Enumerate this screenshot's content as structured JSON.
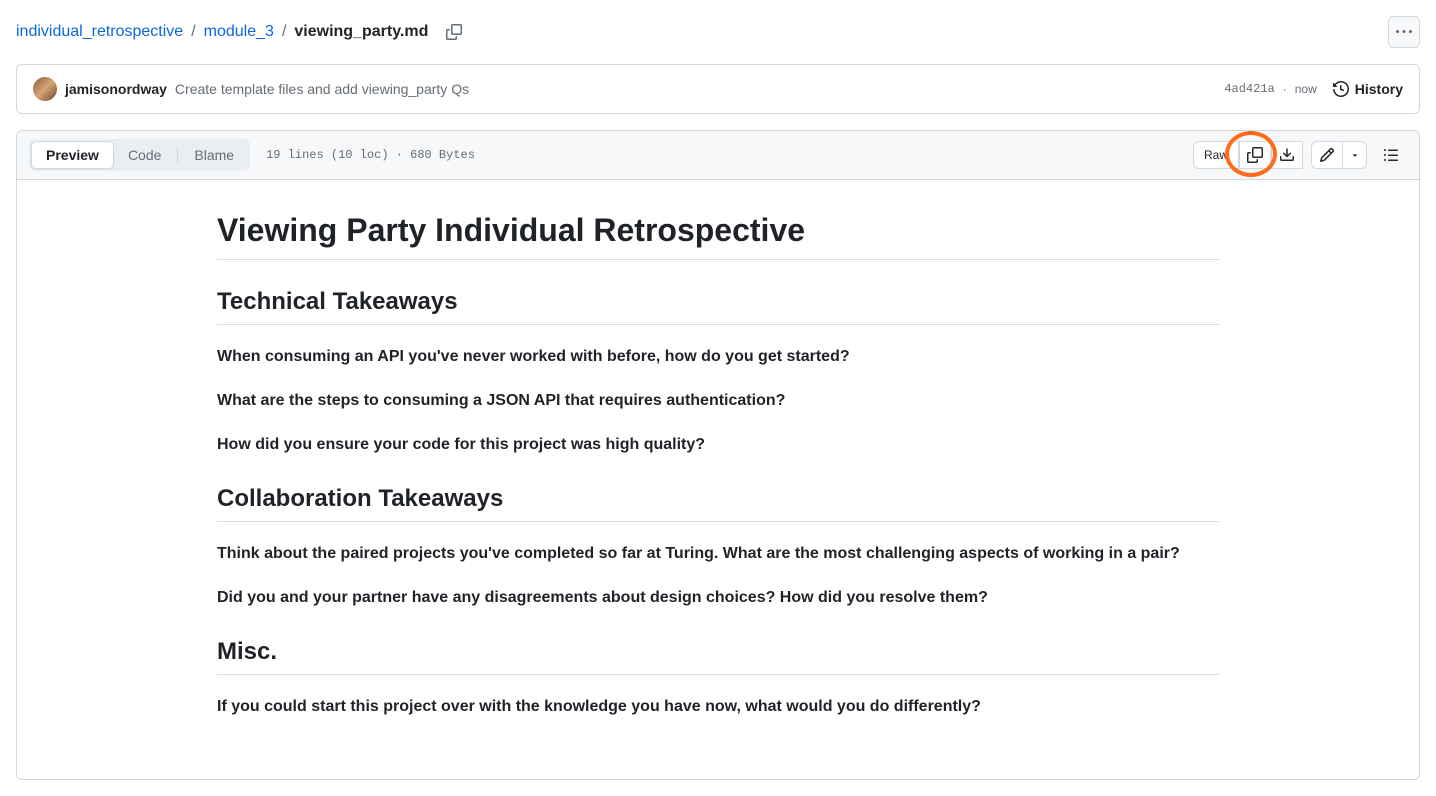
{
  "breadcrumb": {
    "parts": [
      "individual_retrospective",
      "module_3"
    ],
    "current": "viewing_party.md"
  },
  "commit": {
    "author": "jamisonordway",
    "message": "Create template files and add viewing_party Qs",
    "sha": "4ad421a",
    "time": "now",
    "history_label": "History"
  },
  "toolbar": {
    "tabs": {
      "preview": "Preview",
      "code": "Code",
      "blame": "Blame"
    },
    "file_info": "19 lines (10 loc) · 680 Bytes",
    "raw_label": "Raw"
  },
  "content": {
    "h1": "Viewing Party Individual Retrospective",
    "sections": [
      {
        "heading": "Technical Takeaways",
        "questions": [
          "When consuming an API you've never worked with before, how do you get started?",
          "What are the steps to consuming a JSON API that requires authentication?",
          "How did you ensure your code for this project was high quality?"
        ]
      },
      {
        "heading": "Collaboration Takeaways",
        "questions": [
          "Think about the paired projects you've completed so far at Turing. What are the most challenging aspects of working in a pair?",
          "Did you and your partner have any disagreements about design choices? How did you resolve them?"
        ]
      },
      {
        "heading": "Misc.",
        "questions": [
          "If you could start this project over with the knowledge you have now, what would you do differently?"
        ]
      }
    ]
  }
}
